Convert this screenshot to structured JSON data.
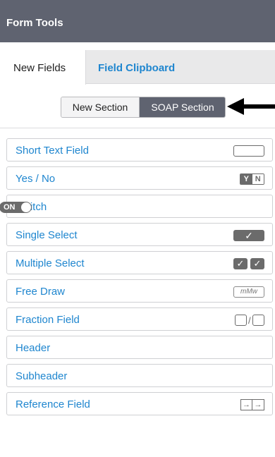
{
  "header": {
    "title": "Form Tools"
  },
  "tabs": [
    {
      "label": "New Fields"
    },
    {
      "label": "Field Clipboard"
    }
  ],
  "section_toggle": {
    "options": [
      "New Section",
      "SOAP Section"
    ],
    "selected": "SOAP Section"
  },
  "fields": [
    {
      "label": "Short Text Field",
      "icon": "text-field-icon"
    },
    {
      "label": "Yes / No",
      "icon": "yes-no-icon",
      "icon_text": [
        "Y",
        "N"
      ]
    },
    {
      "label": "Switch",
      "icon": "switch-icon",
      "icon_text": "ON"
    },
    {
      "label": "Single Select",
      "icon": "single-check-icon",
      "icon_text": "✓"
    },
    {
      "label": "Multiple Select",
      "icon": "multi-check-icon",
      "icon_text": "✓"
    },
    {
      "label": "Free Draw",
      "icon": "draw-icon",
      "icon_text": "mMw"
    },
    {
      "label": "Fraction Field",
      "icon": "fraction-icon",
      "icon_text": "/"
    },
    {
      "label": "Header"
    },
    {
      "label": "Subheader"
    },
    {
      "label": "Reference Field",
      "icon": "reference-icon"
    }
  ],
  "colors": {
    "header": "#5f6370",
    "link": "#1f86cf",
    "selected_segment": "#5f6370"
  }
}
